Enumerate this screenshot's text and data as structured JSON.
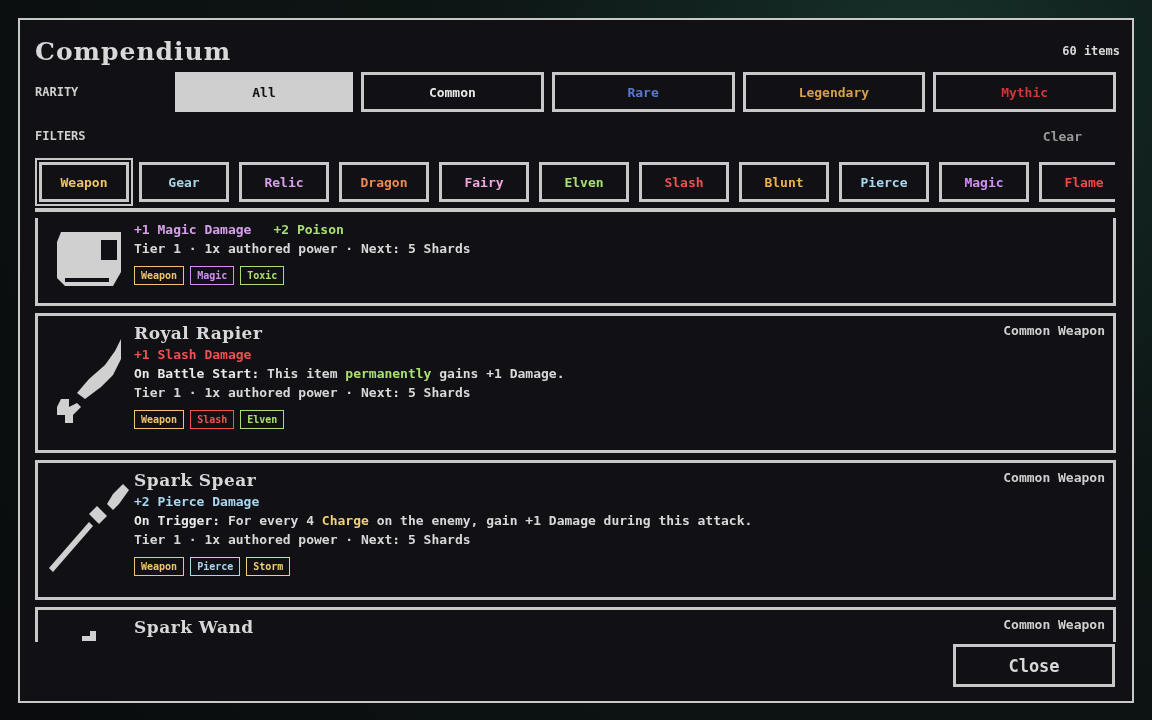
{
  "title": "Compendium",
  "count": "60 items",
  "rarity": {
    "label": "RARITY",
    "options": [
      {
        "label": "All",
        "selected": true,
        "color": "#cfcfcf"
      },
      {
        "label": "Common",
        "selected": false,
        "color": "#e8e8e8"
      },
      {
        "label": "Rare",
        "selected": false,
        "color": "#5a78d0"
      },
      {
        "label": "Legendary",
        "selected": false,
        "color": "#d8a048"
      },
      {
        "label": "Mythic",
        "selected": false,
        "color": "#d03838"
      }
    ]
  },
  "filters": {
    "label": "FILTERS",
    "clear": "Clear",
    "chips": [
      {
        "label": "Weapon",
        "selected": true,
        "color": "#eec56a"
      },
      {
        "label": "Gear",
        "selected": false,
        "color": "#a8d8e8"
      },
      {
        "label": "Relic",
        "selected": false,
        "color": "#d8a0ec"
      },
      {
        "label": "Dragon",
        "selected": false,
        "color": "#f08a50"
      },
      {
        "label": "Fairy",
        "selected": false,
        "color": "#f0a8dc"
      },
      {
        "label": "Elven",
        "selected": false,
        "color": "#a8e070"
      },
      {
        "label": "Slash",
        "selected": false,
        "color": "#f05050"
      },
      {
        "label": "Blunt",
        "selected": false,
        "color": "#f0b050"
      },
      {
        "label": "Pierce",
        "selected": false,
        "color": "#a8d8f0"
      },
      {
        "label": "Magic",
        "selected": false,
        "color": "#d090f0"
      },
      {
        "label": "Flame",
        "selected": false,
        "color": "#f04848"
      }
    ]
  },
  "items": [
    {
      "stats": [
        {
          "text": "+1 Magic Damage",
          "color": "#d8a0ec"
        },
        {
          "text": "+2 Poison",
          "color": "#a8e070"
        }
      ],
      "tier": "Tier 1 · 1x authored power · Next: 5 Shards",
      "tags": [
        {
          "label": "Weapon",
          "color": "#eec56a"
        },
        {
          "label": "Magic",
          "color": "#d090f0"
        },
        {
          "label": "Toxic",
          "color": "#a8e070"
        }
      ]
    },
    {
      "name": "Royal Rapier",
      "rarity": "Common Weapon",
      "stats": [
        {
          "text": "+1 Slash Damage",
          "color": "#f05050"
        }
      ],
      "effect": [
        {
          "text": "On Battle Start:",
          "color": "#e8e8e8"
        },
        {
          "text": " This item ",
          "color": "#d8d8d8"
        },
        {
          "text": "permanently",
          "color": "#a8e070"
        },
        {
          "text": " gains +1 Damage.",
          "color": "#d8d8d8"
        }
      ],
      "tier": "Tier 1 · 1x authored power · Next: 5 Shards",
      "tags": [
        {
          "label": "Weapon",
          "color": "#eec56a"
        },
        {
          "label": "Slash",
          "color": "#f05050"
        },
        {
          "label": "Elven",
          "color": "#a8e070"
        }
      ]
    },
    {
      "name": "Spark Spear",
      "rarity": "Common Weapon",
      "stats": [
        {
          "text": "+2 Pierce Damage",
          "color": "#a8d8f0"
        }
      ],
      "effect": [
        {
          "text": "On Trigger:",
          "color": "#e8e8e8"
        },
        {
          "text": " For every 4 ",
          "color": "#d8d8d8"
        },
        {
          "text": "Charge",
          "color": "#f0d070"
        },
        {
          "text": " on the enemy, gain +1 Damage during this attack.",
          "color": "#d8d8d8"
        }
      ],
      "tier": "Tier 1 · 1x authored power · Next: 5 Shards",
      "tags": [
        {
          "label": "Weapon",
          "color": "#eec56a"
        },
        {
          "label": "Pierce",
          "color": "#a8d8f0"
        },
        {
          "label": "Storm",
          "color": "#f0d070"
        }
      ]
    },
    {
      "name": "Spark Wand",
      "rarity": "Common Weapon"
    }
  ],
  "close": "Close"
}
